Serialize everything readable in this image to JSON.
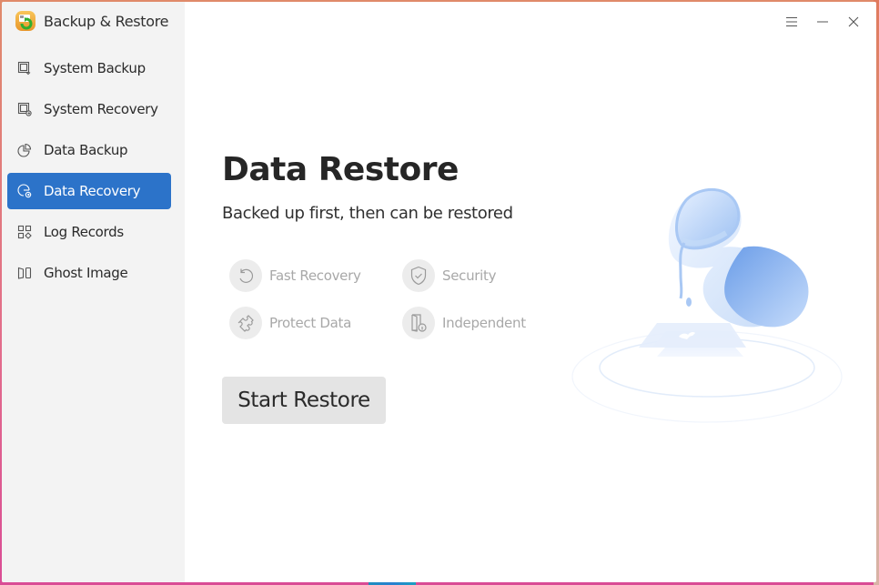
{
  "app": {
    "title": "Backup & Restore",
    "logo_icon": "backup-restore-logo"
  },
  "titlebar": {
    "menu_icon": "hamburger-menu-icon",
    "minimize_icon": "minimize-icon",
    "close_icon": "close-icon"
  },
  "sidebar": {
    "items": [
      {
        "label": "System Backup",
        "icon": "system-backup-icon",
        "active": false
      },
      {
        "label": "System Recovery",
        "icon": "system-recovery-icon",
        "active": false
      },
      {
        "label": "Data Backup",
        "icon": "pie-chart-icon",
        "active": false
      },
      {
        "label": "Data Recovery",
        "icon": "data-recovery-icon",
        "active": true
      },
      {
        "label": "Log Records",
        "icon": "grid-icon",
        "active": false
      },
      {
        "label": "Ghost Image",
        "icon": "ghost-image-icon",
        "active": false
      }
    ],
    "active_color": "#2c73c9"
  },
  "main": {
    "title": "Data Restore",
    "subtitle": "Backed up first, then can be restored",
    "features": [
      {
        "label": "Fast Recovery",
        "icon": "undo-icon"
      },
      {
        "label": "Security",
        "icon": "shield-check-icon"
      },
      {
        "label": "Protect Data",
        "icon": "puzzle-icon"
      },
      {
        "label": "Independent",
        "icon": "door-info-icon"
      }
    ],
    "start_button": "Start Restore",
    "illustration": "hourglass-illustration"
  }
}
